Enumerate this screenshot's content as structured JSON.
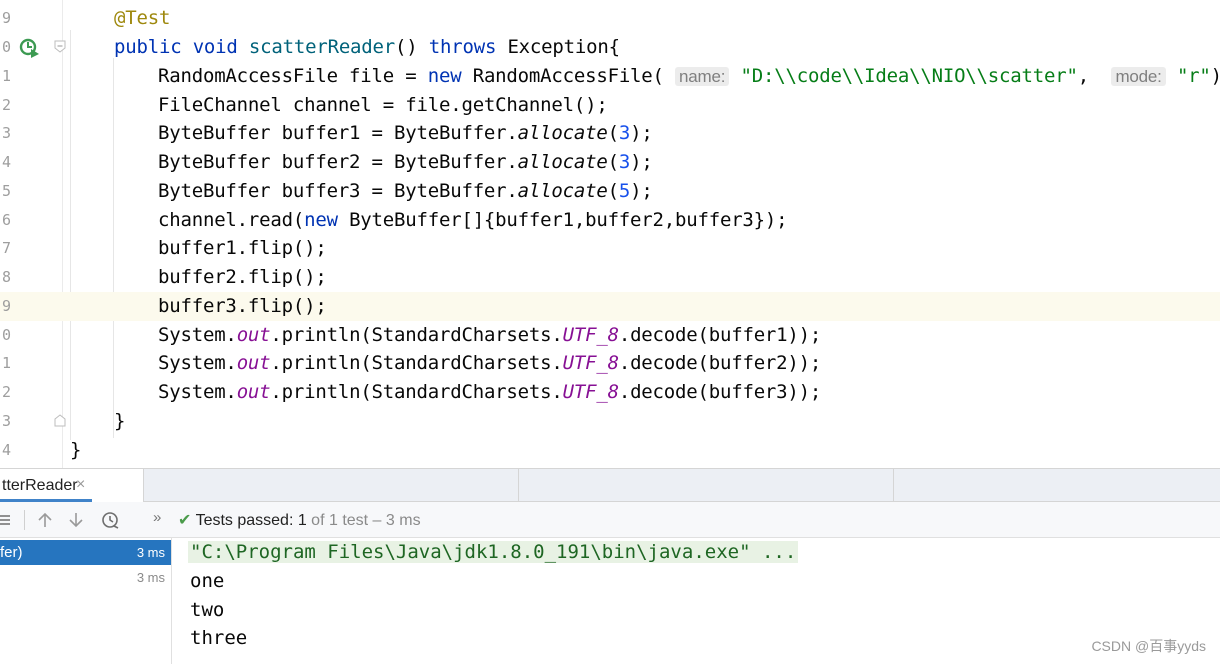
{
  "editor": {
    "line_numbers": [
      "9",
      "0",
      "1",
      "2",
      "3",
      "4",
      "5",
      "6",
      "7",
      "8",
      "9",
      "0",
      "1",
      "2",
      "3",
      "4"
    ],
    "code": {
      "annotation": "@Test",
      "method_sig": [
        "public",
        "void",
        "scatterReader",
        "()",
        "throws",
        "Exception{"
      ],
      "l1_a": "RandomAccessFile file = ",
      "l1_new": "new",
      "l1_b": " RandomAccessFile(",
      "hint_name": "name:",
      "l1_path": "\"D:\\\\code\\\\Idea\\\\NIO\\\\scatter\"",
      "l1_comma": ", ",
      "hint_mode": "mode:",
      "l1_mode": "\"r\"",
      "l1_end": ");",
      "l2": "FileChannel channel = file.getChannel();",
      "bb_prefix": [
        "ByteBuffer buffer1 = ByteBuffer.",
        "ByteBuffer buffer2 = ByteBuffer.",
        "ByteBuffer buffer3 = ByteBuffer."
      ],
      "allocate": "allocate",
      "bb_args": [
        "3",
        "3",
        "5"
      ],
      "read_a": "channel.read(",
      "read_new": "new",
      "read_b": " ByteBuffer[]{buffer1,buffer2,buffer3});",
      "flips": [
        "buffer1.flip();",
        "buffer2.flip();",
        "buffer3.flip();"
      ],
      "sys": "System.",
      "out": "out",
      "println": ".println(StandardCharsets.",
      "utf8": "UTF_8",
      "decodes": [
        ".decode(buffer1));",
        ".decode(buffer2));",
        ".decode(buffer3));"
      ],
      "close_method": "}",
      "close_class": "}"
    }
  },
  "tabs": {
    "run_tab_label": "tterReader",
    "close_glyph": "×"
  },
  "toolbar": {
    "expand_label": "»",
    "status_check": "✔",
    "status_passed": "Tests passed:",
    "status_count": " 1",
    "status_rest": " of 1 test – 3 ms"
  },
  "tree": {
    "rows": [
      {
        "name": "fer)",
        "time": "3 ms"
      },
      {
        "name": "",
        "time": "3 ms"
      }
    ]
  },
  "console": {
    "lines": [
      "\"C:\\Program Files\\Java\\jdk1.8.0_191\\bin\\java.exe\" ...",
      "one",
      "two",
      "three"
    ]
  },
  "watermark": "CSDN @百事yyds",
  "colors": {
    "keyword": "#0033b3",
    "annotation": "#9e880d",
    "string": "#067d17",
    "number": "#1750eb",
    "static_field": "#871094",
    "selection": "#2675bf",
    "caret_line": "#fcfaed"
  }
}
